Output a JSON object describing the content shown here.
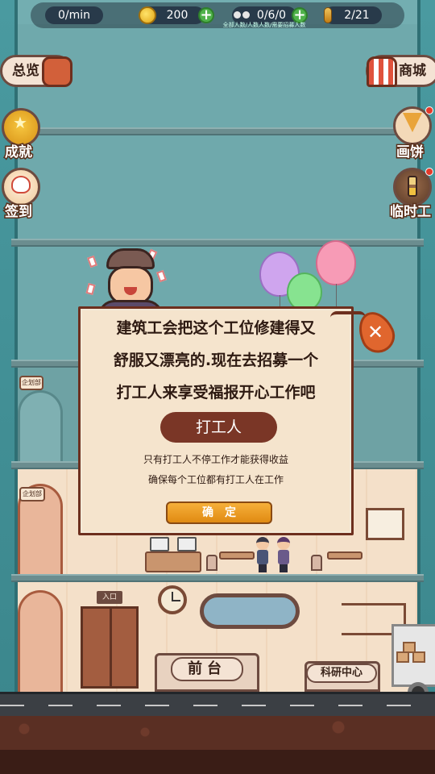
{
  "topbar": {
    "income_rate": "0/min",
    "coins": "200",
    "workers": "0/6/0",
    "workers_sublabel": "全部人数/人数人数/需要招募人数",
    "stamina": "2/21"
  },
  "side_menu": {
    "left": [
      {
        "label": "总览",
        "icon": "briefcase-icon"
      },
      {
        "label": "成就",
        "icon": "trophy-icon"
      },
      {
        "label": "签到",
        "icon": "lucky-cat-icon"
      }
    ],
    "right": [
      {
        "label": "商城",
        "icon": "shop-icon"
      },
      {
        "label": "画饼",
        "icon": "pizza-icon"
      },
      {
        "label": "临时工",
        "icon": "hourglass-icon"
      }
    ]
  },
  "scene": {
    "planning_dept_sign": "企划部",
    "entrance_sign": "入口",
    "reception_label": "前台",
    "rnd_label": "科研中心"
  },
  "dialog": {
    "message_lines": [
      "建筑工会把这个工位修建得又",
      "舒服又漂亮的.现在去招募一个",
      "打工人来享受福报开心工作吧"
    ],
    "worker_button": "打工人",
    "note_lines": [
      "只有打工人不停工作才能获得收益",
      "确保每个工位都有打工人在工作"
    ],
    "confirm_button": "确定"
  },
  "colors": {
    "dialog_bg": "#f5e4cd",
    "dialog_border": "#6d2f1e",
    "worker_button": "#7a3626",
    "confirm_button": "#e08a12",
    "close_leaf": "#e0662e"
  }
}
